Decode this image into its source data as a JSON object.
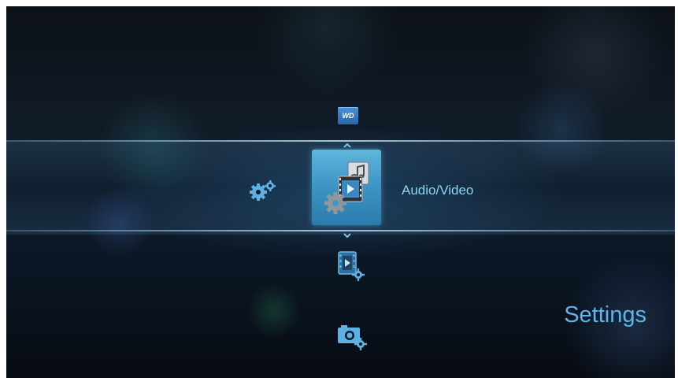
{
  "menu": {
    "items": [
      {
        "name": "wd-home",
        "icon": "wd-logo-icon",
        "label": "WD"
      },
      {
        "name": "settings",
        "icon": "gears-icon"
      },
      {
        "name": "audio-video",
        "icon": "audio-video-settings-icon",
        "label": "Audio/Video",
        "selected": true
      },
      {
        "name": "video-settings",
        "icon": "video-settings-icon"
      },
      {
        "name": "photo-settings",
        "icon": "photo-settings-icon"
      }
    ],
    "selected_label": "Audio/Video"
  },
  "page": {
    "title": "Settings"
  },
  "colors": {
    "accent": "#60b4e6",
    "label": "#8fd4f0",
    "tile": "#3f97c6",
    "wd_badge": "#2b65a8"
  }
}
